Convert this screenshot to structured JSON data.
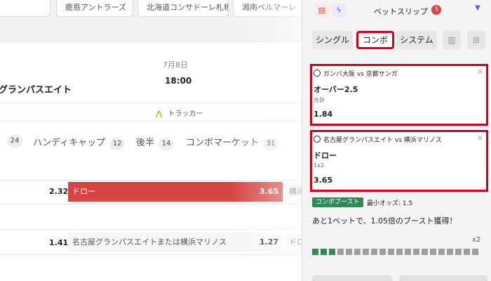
{
  "team_tabs": [
    "",
    "鹿島アントラーズ",
    "北海道コンサドーレ札幌",
    "湘南ベルマーレ"
  ],
  "match": {
    "team": "グランパスエイト",
    "date": "7月8日",
    "time": "18:00",
    "tracker_label": "トラッカー"
  },
  "market_tabs": [
    {
      "label": "",
      "count": "24"
    },
    {
      "label": "ハンディキャップ",
      "count": "12"
    },
    {
      "label": "後半",
      "count": "14"
    },
    {
      "label": "コンボマーケット",
      "count": "31"
    }
  ],
  "odds_rows": {
    "row1": {
      "left_odds": "2.32",
      "selected_label": "ドロー",
      "selected_odds": "3.65",
      "right_stub": "横浜"
    },
    "row2": {
      "left_odds": "1.41",
      "label": "名古屋グランパスエイトまたは横浜マリノス",
      "odds": "1.27",
      "right_stub": "ドロ"
    }
  },
  "colors": {
    "selected": "#d64541",
    "highlight_border": "#d0021b",
    "boost_green": "#2e8b57"
  },
  "slip": {
    "title": "ベットスリップ",
    "count": "3",
    "header_icons": [
      "receipt-icon",
      "lightning-icon"
    ],
    "modes": [
      "シングル",
      "コンボ",
      "システム"
    ],
    "active_mode": "コンボ",
    "bets": [
      {
        "match": "ガンバ大阪 vs 京都サンガ",
        "selection": "オーバー2.5",
        "market": "合計",
        "odds": "1.84"
      },
      {
        "match": "名古屋グランパスエイト vs 横浜マリノス",
        "selection": "ドロー",
        "market": "1x2",
        "odds": "3.65"
      }
    ],
    "boost": {
      "tag": "コンボブースト",
      "min_odds_label": "最小オッズ: 1.5",
      "message": "あと1ベットで、1.05倍のブースト獲得！",
      "multiplier": "x2",
      "segments_total": 20,
      "segments_filled": 3
    }
  }
}
